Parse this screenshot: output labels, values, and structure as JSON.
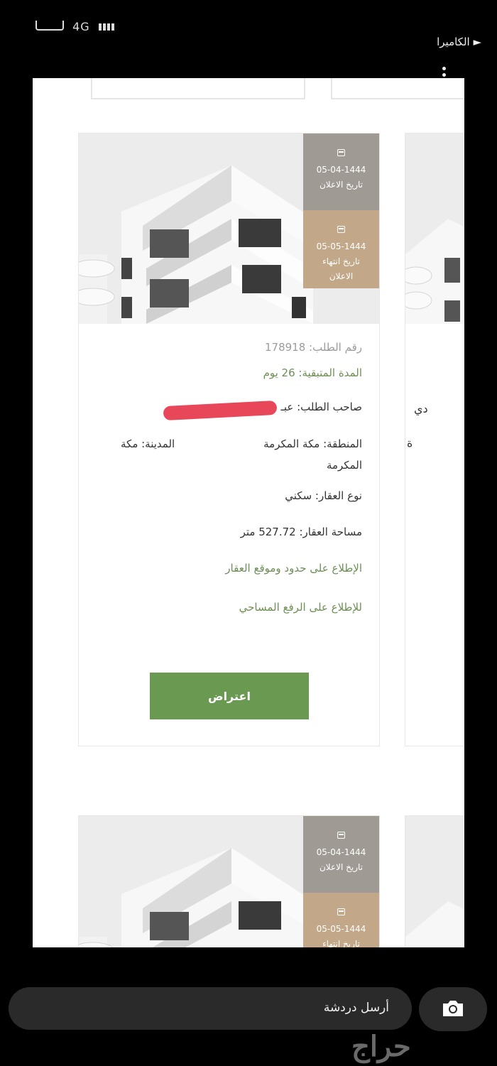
{
  "status_bar": {
    "network": "4G"
  },
  "top_bar": {
    "camera_link": "► الكاميرا"
  },
  "listing_card": {
    "announce": {
      "date": "05-04-1444",
      "label": "تاريخ الاعلان"
    },
    "expiry": {
      "date": "05-05-1444",
      "label_line1": "تاريخ انتهاء",
      "label_line2": "الاعلان"
    },
    "request_no": "رقم الطلب: 178918",
    "remaining": "المدة المتبقية: 26 يوم",
    "owner": "صاحب الطلب: عبـ",
    "region": "المنطقة: مكة المكرمة",
    "city_part1": "المدينة: مكة",
    "city_part2": "المكرمة",
    "property_type": "نوع العقار: سكني",
    "area": "مساحة العقار: 527.72 متر",
    "link_boundaries": "الإطلاع على حدود وموقع العقار",
    "link_survey": "للإطلاع على الرفع المساحي",
    "object_button": "اعتراض"
  },
  "second_card": {
    "announce": {
      "date": "05-04-1444",
      "label": "تاريخ الاعلان"
    },
    "expiry": {
      "date": "05-05-1444",
      "label_line1": "تاريخ انتهاء"
    }
  },
  "side_card_fragments": {
    "owner_tail": "دي",
    "region_tail": "ة"
  },
  "chat": {
    "placeholder": "أرسل دردشة"
  },
  "watermark": {
    "text": "حراج"
  },
  "colors": {
    "accent_green": "#6a9a52",
    "announce_box": "#a09a94",
    "expiry_box": "#c2a889",
    "redaction": "#e8475a"
  },
  "icons": {
    "camera": "camera-icon",
    "calendar": "calendar-icon",
    "menu": "kebab-menu-icon"
  }
}
